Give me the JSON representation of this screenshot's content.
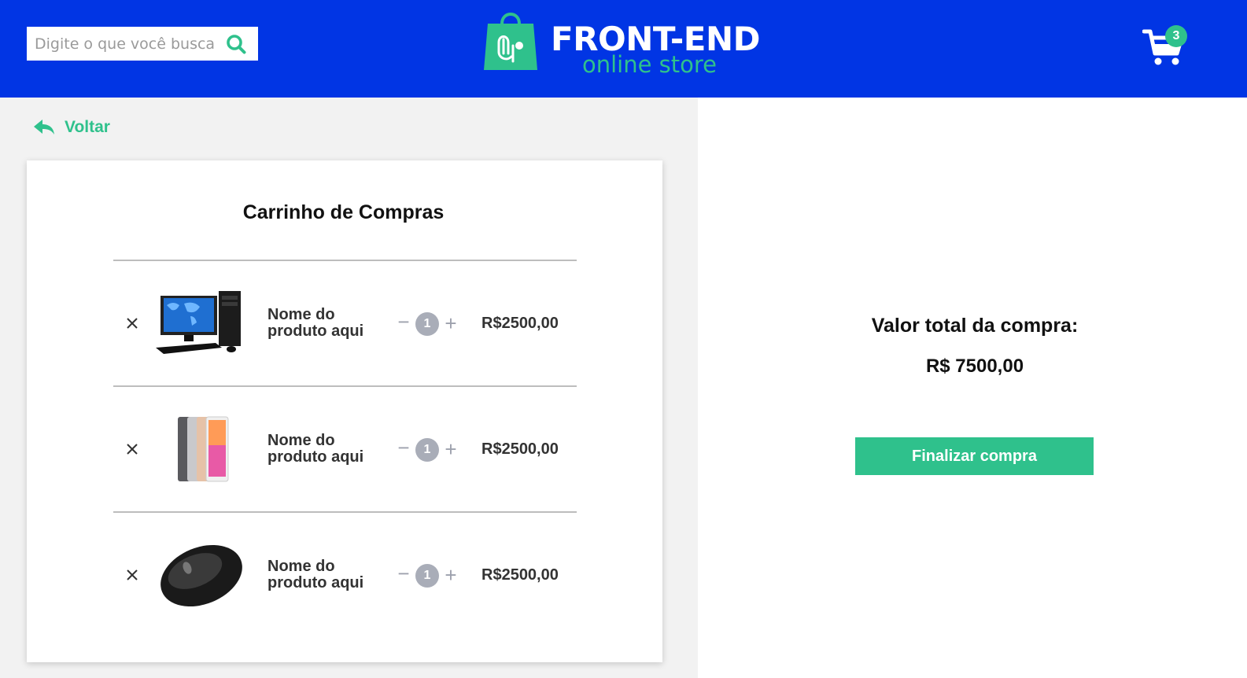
{
  "header": {
    "search": {
      "placeholder": "Digite o que você busca",
      "value": ""
    },
    "logo": {
      "title": "FRONT-END",
      "subtitle": "online store"
    },
    "cart_count": "3"
  },
  "nav": {
    "back_label": "Voltar"
  },
  "cart": {
    "title": "Carrinho de Compras",
    "items": [
      {
        "name": "Nome do produto aqui",
        "quantity": "1",
        "price": "R$2500,00",
        "image": "desktop-computer"
      },
      {
        "name": "Nome do produto aqui",
        "quantity": "1",
        "price": "R$2500,00",
        "image": "tablets"
      },
      {
        "name": "Nome do produto aqui",
        "quantity": "1",
        "price": "R$2500,00",
        "image": "computer-mouse"
      }
    ]
  },
  "summary": {
    "label": "Valor total da compra:",
    "total": "R$ 7500,00",
    "checkout_label": "Finalizar compra"
  },
  "colors": {
    "header_bg": "#0135E4",
    "accent": "#2FC18C",
    "panel_bg": "#F2F2F2"
  }
}
